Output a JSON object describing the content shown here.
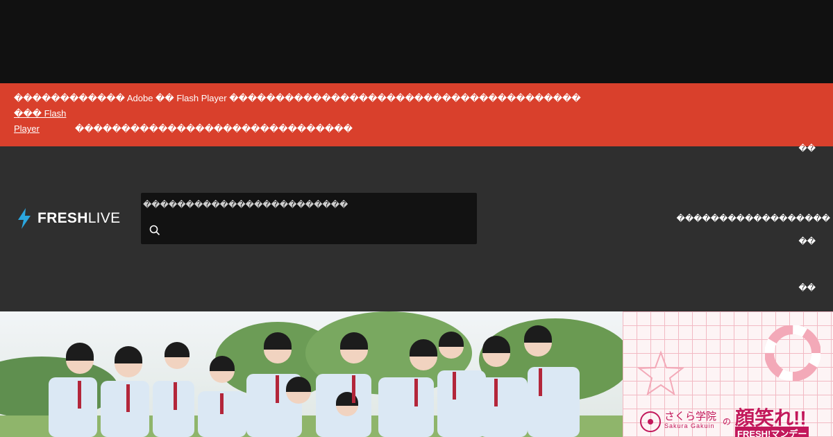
{
  "notice": {
    "line1": "������������ Adobe �� Flash Player ��������������������������������������",
    "link_part1": "��� Flash",
    "link_part2": "Player",
    "line2": "������������������������������"
  },
  "header": {
    "logo": {
      "bold": "FRESH",
      "light": "LIVE",
      "accent_color": "#2ba6de"
    },
    "search": {
      "placeholder": "������������������������"
    },
    "nav": {
      "item1": "��",
      "item2": "������������������",
      "item3": "��",
      "item4": "��"
    }
  },
  "banner": {
    "side": {
      "japanese_title": "さくら学院",
      "english_title": "Sakura Gakuin",
      "particle": "の",
      "headline": "顔笑れ!!",
      "subline": "FRESH!マンデー"
    }
  },
  "colors": {
    "notice_bg": "#d9402c",
    "header_bg": "#2f2f2f",
    "top_bg": "#111111",
    "search_bg": "#121212",
    "brand_pink": "#c2185b"
  }
}
